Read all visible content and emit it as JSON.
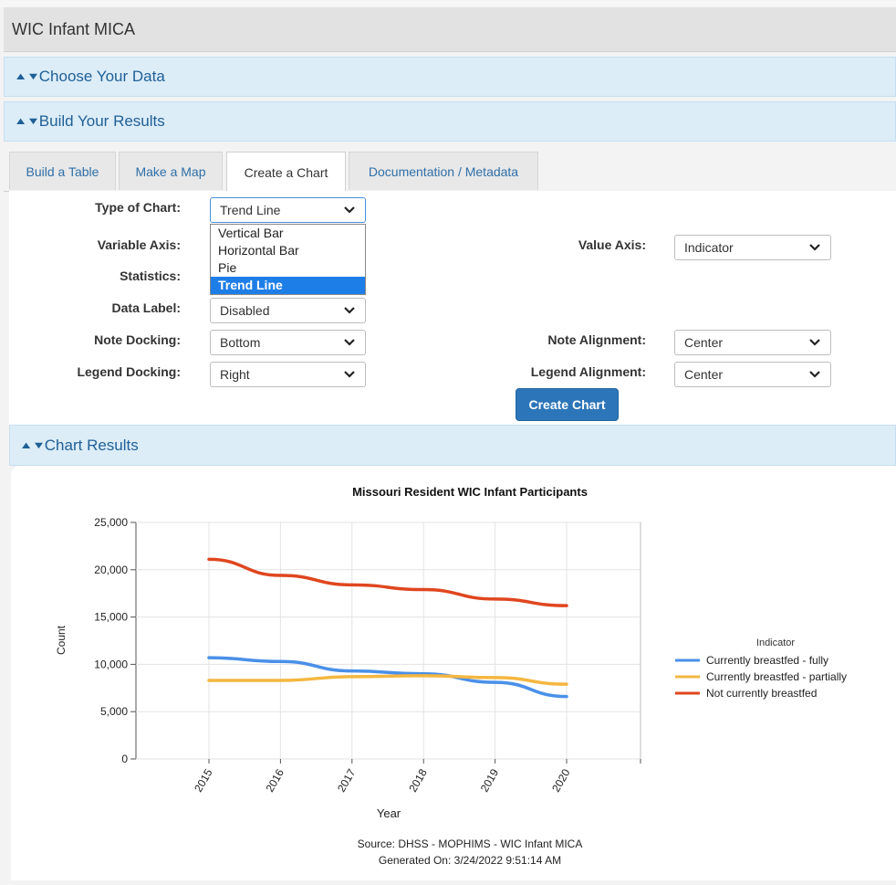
{
  "app": {
    "title": "WIC Infant MICA"
  },
  "panels": {
    "choose_data": "Choose Your Data",
    "build_results": "Build Your Results",
    "chart_results": "Chart Results"
  },
  "tabs": [
    {
      "label": "Build a Table"
    },
    {
      "label": "Make a Map"
    },
    {
      "label": "Create a Chart"
    },
    {
      "label": "Documentation / Metadata"
    }
  ],
  "form": {
    "type_of_chart": {
      "label": "Type of Chart:",
      "value": "Trend Line",
      "options": [
        "Vertical Bar",
        "Horizontal Bar",
        "Pie",
        "Trend Line"
      ]
    },
    "variable_axis": {
      "label": "Variable Axis:"
    },
    "statistics": {
      "label": "Statistics:"
    },
    "value_axis": {
      "label": "Value Axis:",
      "value": "Indicator"
    },
    "data_label": {
      "label": "Data Label:",
      "value": "Disabled"
    },
    "note_docking": {
      "label": "Note Docking:",
      "value": "Bottom"
    },
    "note_alignment": {
      "label": "Note Alignment:",
      "value": "Center"
    },
    "legend_docking": {
      "label": "Legend Docking:",
      "value": "Right"
    },
    "legend_alignment": {
      "label": "Legend Alignment:",
      "value": "Center"
    },
    "create_button": "Create Chart"
  },
  "chart_data": {
    "type": "line",
    "title": "Missouri Resident WIC Infant Participants",
    "xlabel": "Year",
    "ylabel": "Count",
    "x": [
      "2015",
      "2016",
      "2017",
      "2018",
      "2019",
      "2020"
    ],
    "ylim": [
      0,
      25000
    ],
    "yticks": [
      0,
      5000,
      10000,
      15000,
      20000,
      25000
    ],
    "ytick_labels": [
      "0",
      "5,000",
      "10,000",
      "15,000",
      "20,000",
      "25,000"
    ],
    "grid": true,
    "legend": {
      "title": "Indicator",
      "placement": "right"
    },
    "series": [
      {
        "name": "Currently breastfed - fully",
        "color": "#4a90e8",
        "values": [
          10700,
          10300,
          9300,
          9000,
          8100,
          6600
        ]
      },
      {
        "name": "Currently breastfed - partially",
        "color": "#f4b740",
        "values": [
          8300,
          8300,
          8700,
          8800,
          8600,
          7900
        ]
      },
      {
        "name": "Not currently breastfed",
        "color": "#e0461f",
        "values": [
          21100,
          19400,
          18400,
          17900,
          16900,
          16200
        ]
      }
    ],
    "note_source": "Source: DHSS - MOPHIMS - WIC Infant MICA",
    "note_generated": "Generated On: 3/24/2022 9:51:14 AM"
  }
}
